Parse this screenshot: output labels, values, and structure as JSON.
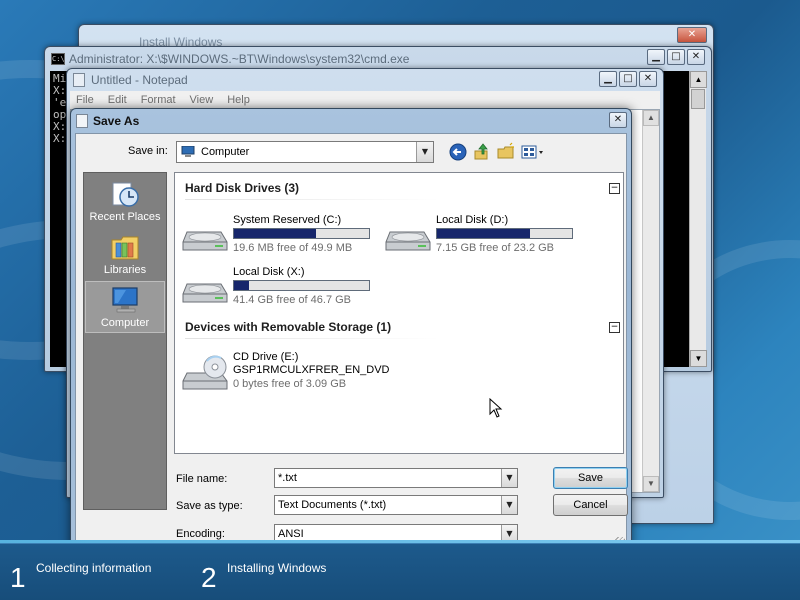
{
  "setup": {
    "steps": [
      {
        "num": "1",
        "label": "Collecting information"
      },
      {
        "num": "2",
        "label": "Installing Windows"
      }
    ]
  },
  "install_window": {
    "title": "Install Windows"
  },
  "cmd_window": {
    "title": "Administrator: X:\\$WINDOWS.~BT\\Windows\\system32\\cmd.exe",
    "lines": [
      "Mi",
      "",
      "X:",
      "'e",
      "op",
      "",
      "X:",
      "",
      "X:"
    ],
    "icon_text": "C:\\"
  },
  "notepad": {
    "title": "Untitled - Notepad",
    "menu": [
      "File",
      "Edit",
      "Format",
      "View",
      "Help"
    ]
  },
  "save_as": {
    "title": "Save As",
    "save_in_label": "Save in:",
    "save_in_value": "Computer",
    "places": [
      {
        "label": "Recent Places",
        "icon": "recent-places-icon"
      },
      {
        "label": "Libraries",
        "icon": "libraries-icon"
      },
      {
        "label": "Computer",
        "icon": "computer-icon"
      }
    ],
    "groups": [
      {
        "header": "Hard Disk Drives (3)",
        "collapse": "−"
      },
      {
        "header": "Devices with Removable Storage (1)",
        "collapse": "−"
      }
    ],
    "drives": [
      {
        "name": "System Reserved (C:)",
        "free": "19.6 MB free of 49.9 MB",
        "used_fraction": 0.61
      },
      {
        "name": "Local Disk (D:)",
        "free": "7.15 GB free of 23.2 GB",
        "used_fraction": 0.69
      },
      {
        "name": "Local Disk (X:)",
        "free": "41.4 GB free of 46.7 GB",
        "used_fraction": 0.11
      }
    ],
    "cd_drive": {
      "name": "CD Drive (E:)",
      "label": "GSP1RMCULXFRER_EN_DVD",
      "free": "0 bytes free of 3.09 GB"
    },
    "file_name_label": "File name:",
    "file_name_value": "*.txt",
    "save_as_type_label": "Save as type:",
    "save_as_type_value": "Text Documents (*.txt)",
    "encoding_label": "Encoding:",
    "encoding_value": "ANSI",
    "save_button": "Save",
    "cancel_button": "Cancel"
  },
  "colors": {
    "drive_bar_fill": "#16266b",
    "places_bar": "#808080",
    "dialog_frame": "#a9c3de"
  }
}
